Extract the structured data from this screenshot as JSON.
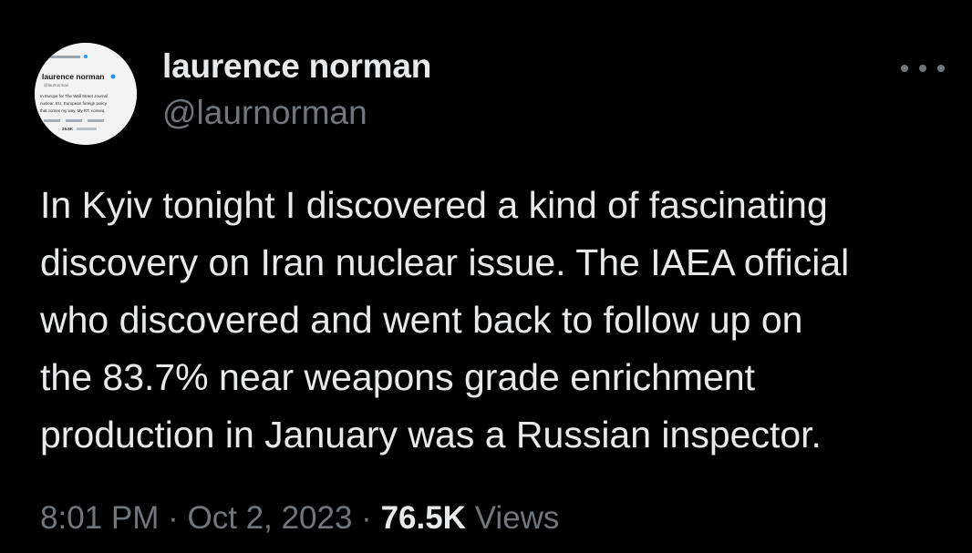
{
  "author": {
    "display_name": "laurence norman",
    "handle": "@laurnorman",
    "avatar_text": {
      "name": "laurence norman",
      "handle": "@laurnorman",
      "bio_line_1": "In Europe for The Wall Street Journal",
      "bio_line_2": "nuclear, EU, European foreign policy",
      "bio_line_3": "that comes my way. My RT, conseq",
      "followers": "26.8K"
    }
  },
  "more_icon": "more-horizontal-icon",
  "tweet": {
    "lines": [
      "In Kyiv tonight I discovered a kind of fascinating",
      "discovery on Iran nuclear issue. The IAEA official",
      "who discovered and went back to follow up on",
      "the 83.7% near weapons grade enrichment",
      "production in January was a Russian inspector."
    ]
  },
  "meta": {
    "time": "8:01 PM",
    "separator": "·",
    "date": "Oct 2, 2023",
    "views_count": "76.5K",
    "views_label": "Views"
  },
  "colors": {
    "background": "#000000",
    "primary_text": "#e7e9ea",
    "secondary_text": "#71767b"
  }
}
